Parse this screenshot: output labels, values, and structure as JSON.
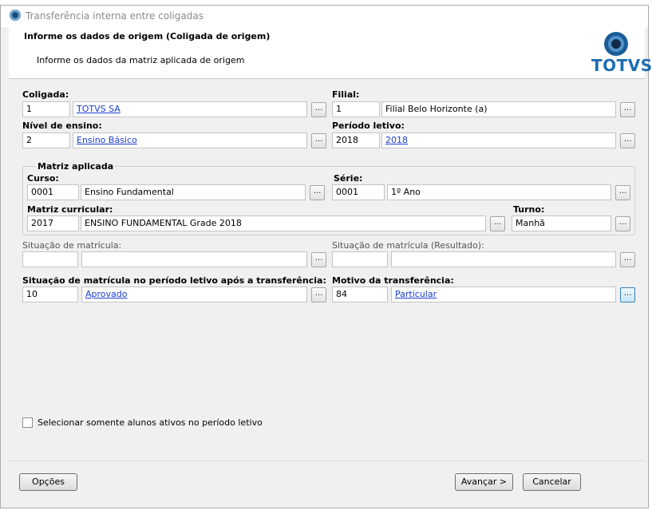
{
  "window": {
    "title": "Transferência interna entre coligadas"
  },
  "header": {
    "title": "Informe os dados de origem (Coligada de origem)",
    "subtitle": "Informe os dados da matriz aplicada de origem",
    "logo_text": "TOTVS"
  },
  "form": {
    "coligada": {
      "label": "Coligada:",
      "code": "1",
      "name": "TOTVS SA"
    },
    "filial": {
      "label": "Filial:",
      "code": "1",
      "name": "Filial Belo Horizonte (a)"
    },
    "nivel": {
      "label": "Nível de ensino:",
      "code": "2",
      "name": "Ensino Básico"
    },
    "periodo": {
      "label": "Período letivo:",
      "code": "2018",
      "name": "2018"
    },
    "matriz": {
      "group_title": "Matriz aplicada",
      "curso": {
        "label": "Curso:",
        "code": "0001",
        "name": "Ensino Fundamental"
      },
      "serie": {
        "label": "Série:",
        "code": "0001",
        "name": "1º Ano"
      },
      "matriz_curricular": {
        "label": "Matriz curricular:",
        "code": "2017",
        "name": "ENSINO FUNDAMENTAL Grade 2018"
      },
      "turno": {
        "label": "Turno:",
        "value": "Manhã"
      }
    },
    "situacao": {
      "label": "Situação de matrícula:",
      "code": "",
      "name": ""
    },
    "situacao_resultado": {
      "label": "Situação de matrícula (Resultado):",
      "code": "",
      "name": ""
    },
    "situacao_apos": {
      "label": "Situação de matrícula no período letivo após a transferência:",
      "code": "10",
      "name": "Aprovado"
    },
    "motivo": {
      "label": "Motivo da transferência:",
      "code": "84",
      "name": "Particular"
    },
    "lookup_button": "...",
    "checkbox": {
      "label": "Selecionar somente alunos ativos no período letivo",
      "checked": false
    }
  },
  "footer": {
    "options": "Opções",
    "next": "Avançar >",
    "cancel": "Cancelar"
  }
}
